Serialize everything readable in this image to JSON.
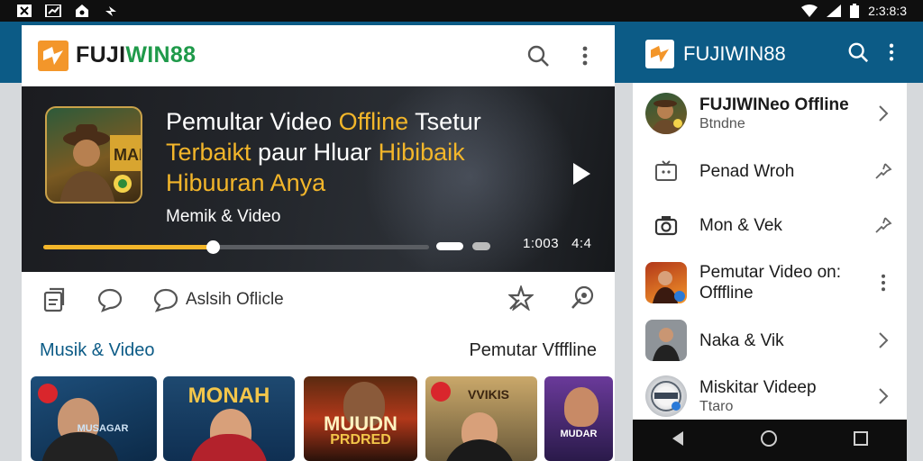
{
  "status": {
    "time": "2:3:8:3"
  },
  "colors": {
    "primary": "#0c5b86",
    "accent": "#f3b62a",
    "brand_green": "#1f9a4a",
    "logo_orange": "#f3962a"
  },
  "left_app": {
    "brand_part1": "FUJI",
    "brand_part2": "WIN88",
    "hero": {
      "title_line1_plain": "Pemultar Video ",
      "title_line1_hl": "Offline",
      "title_line1_end": " Tsetur",
      "title_line2_hl1": "Terbaikt",
      "title_line2_plain": " paur Hluar ",
      "title_line2_hl2": "Hibibaik",
      "title_line3_hl": "Hibuuran Anya",
      "subtitle": "Memik & Video",
      "thumb_text": "MAI",
      "time": "1:003",
      "time_end": "4:4",
      "progress": 0.44
    },
    "toolbar": {
      "tool3_label": "Aslsih Oflicle"
    },
    "section_left": "Musik & Video",
    "section_right": "Pemutar Vfffline",
    "posters": [
      {
        "text": "MUSAGAR"
      },
      {
        "text": "MONAH"
      },
      {
        "text1": "MUUDN",
        "text2": "PRDRED"
      },
      {
        "text": "VVIKIS"
      },
      {
        "text": "MUDAR"
      }
    ]
  },
  "right_app": {
    "brand": "FUJIWIN88",
    "items": [
      {
        "title": "FUJIWINeo Offline",
        "subtitle": "Btndne",
        "trail": "chevron"
      },
      {
        "title": "Penad Wroh",
        "trail": "pin"
      },
      {
        "title": "Mon & Vek",
        "trail": "pin"
      },
      {
        "title": "Pemutar Video on:",
        "title2": "Offfline",
        "trail": "kebab"
      },
      {
        "title": "Naka & Vik",
        "trail": "chevron"
      },
      {
        "title": "Miskitar Videep",
        "subtitle": "Ttaro",
        "trail": "chevron"
      }
    ]
  }
}
